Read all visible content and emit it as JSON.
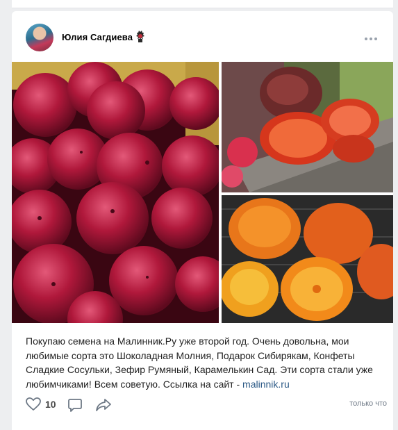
{
  "post": {
    "author": "Юлия Сагдиева",
    "text_before_link": "Покупаю семена на Малинник.Ру уже второй год. Очень довольна, мои любимые сорта это Шоколадная Молния, Подарок Сибирякам, Конфеты Сладкие Сосульки, Зефир Румяный, Карамелькин Сад. Эти сорта стали уже любимчиками! Всем советую. Ссылка на сайт - ",
    "link_text": "malinnik.ru",
    "likes": "10",
    "timestamp": "только что"
  },
  "icons": {
    "verified": "verified-badge-icon",
    "more": "more-dots-icon",
    "like": "heart-icon",
    "comment": "comment-icon",
    "share": "share-arrow-icon"
  },
  "colors": {
    "link": "#2a5885",
    "icon": "#6d7885",
    "background": "#edeef0"
  }
}
